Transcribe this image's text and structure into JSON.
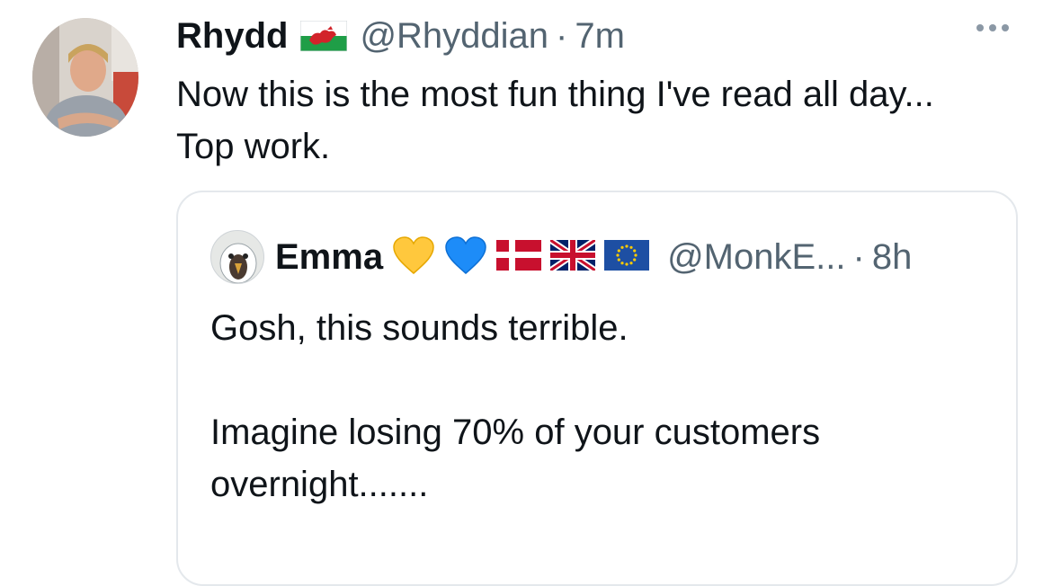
{
  "tweet": {
    "name": "Rhydd",
    "handle": "@Rhyddian",
    "separator": "·",
    "time": "7m",
    "text": "Now this is the most fun thing I've read all day... Top work.",
    "flag": "wales-flag-icon"
  },
  "quote": {
    "name": "Emma",
    "handle": "@MonkE...",
    "separator": "·",
    "time": "8h",
    "emojis": [
      "yellow-heart-icon",
      "blue-heart-icon",
      "denmark-flag-icon",
      "uk-flag-icon",
      "eu-flag-icon"
    ],
    "line1": "Gosh, this sounds terrible.",
    "line2": "Imagine losing 70% of your customers overnight......."
  },
  "colors": {
    "text": "#0f1419",
    "secondary": "#536471",
    "border": "#e4e8ec"
  }
}
